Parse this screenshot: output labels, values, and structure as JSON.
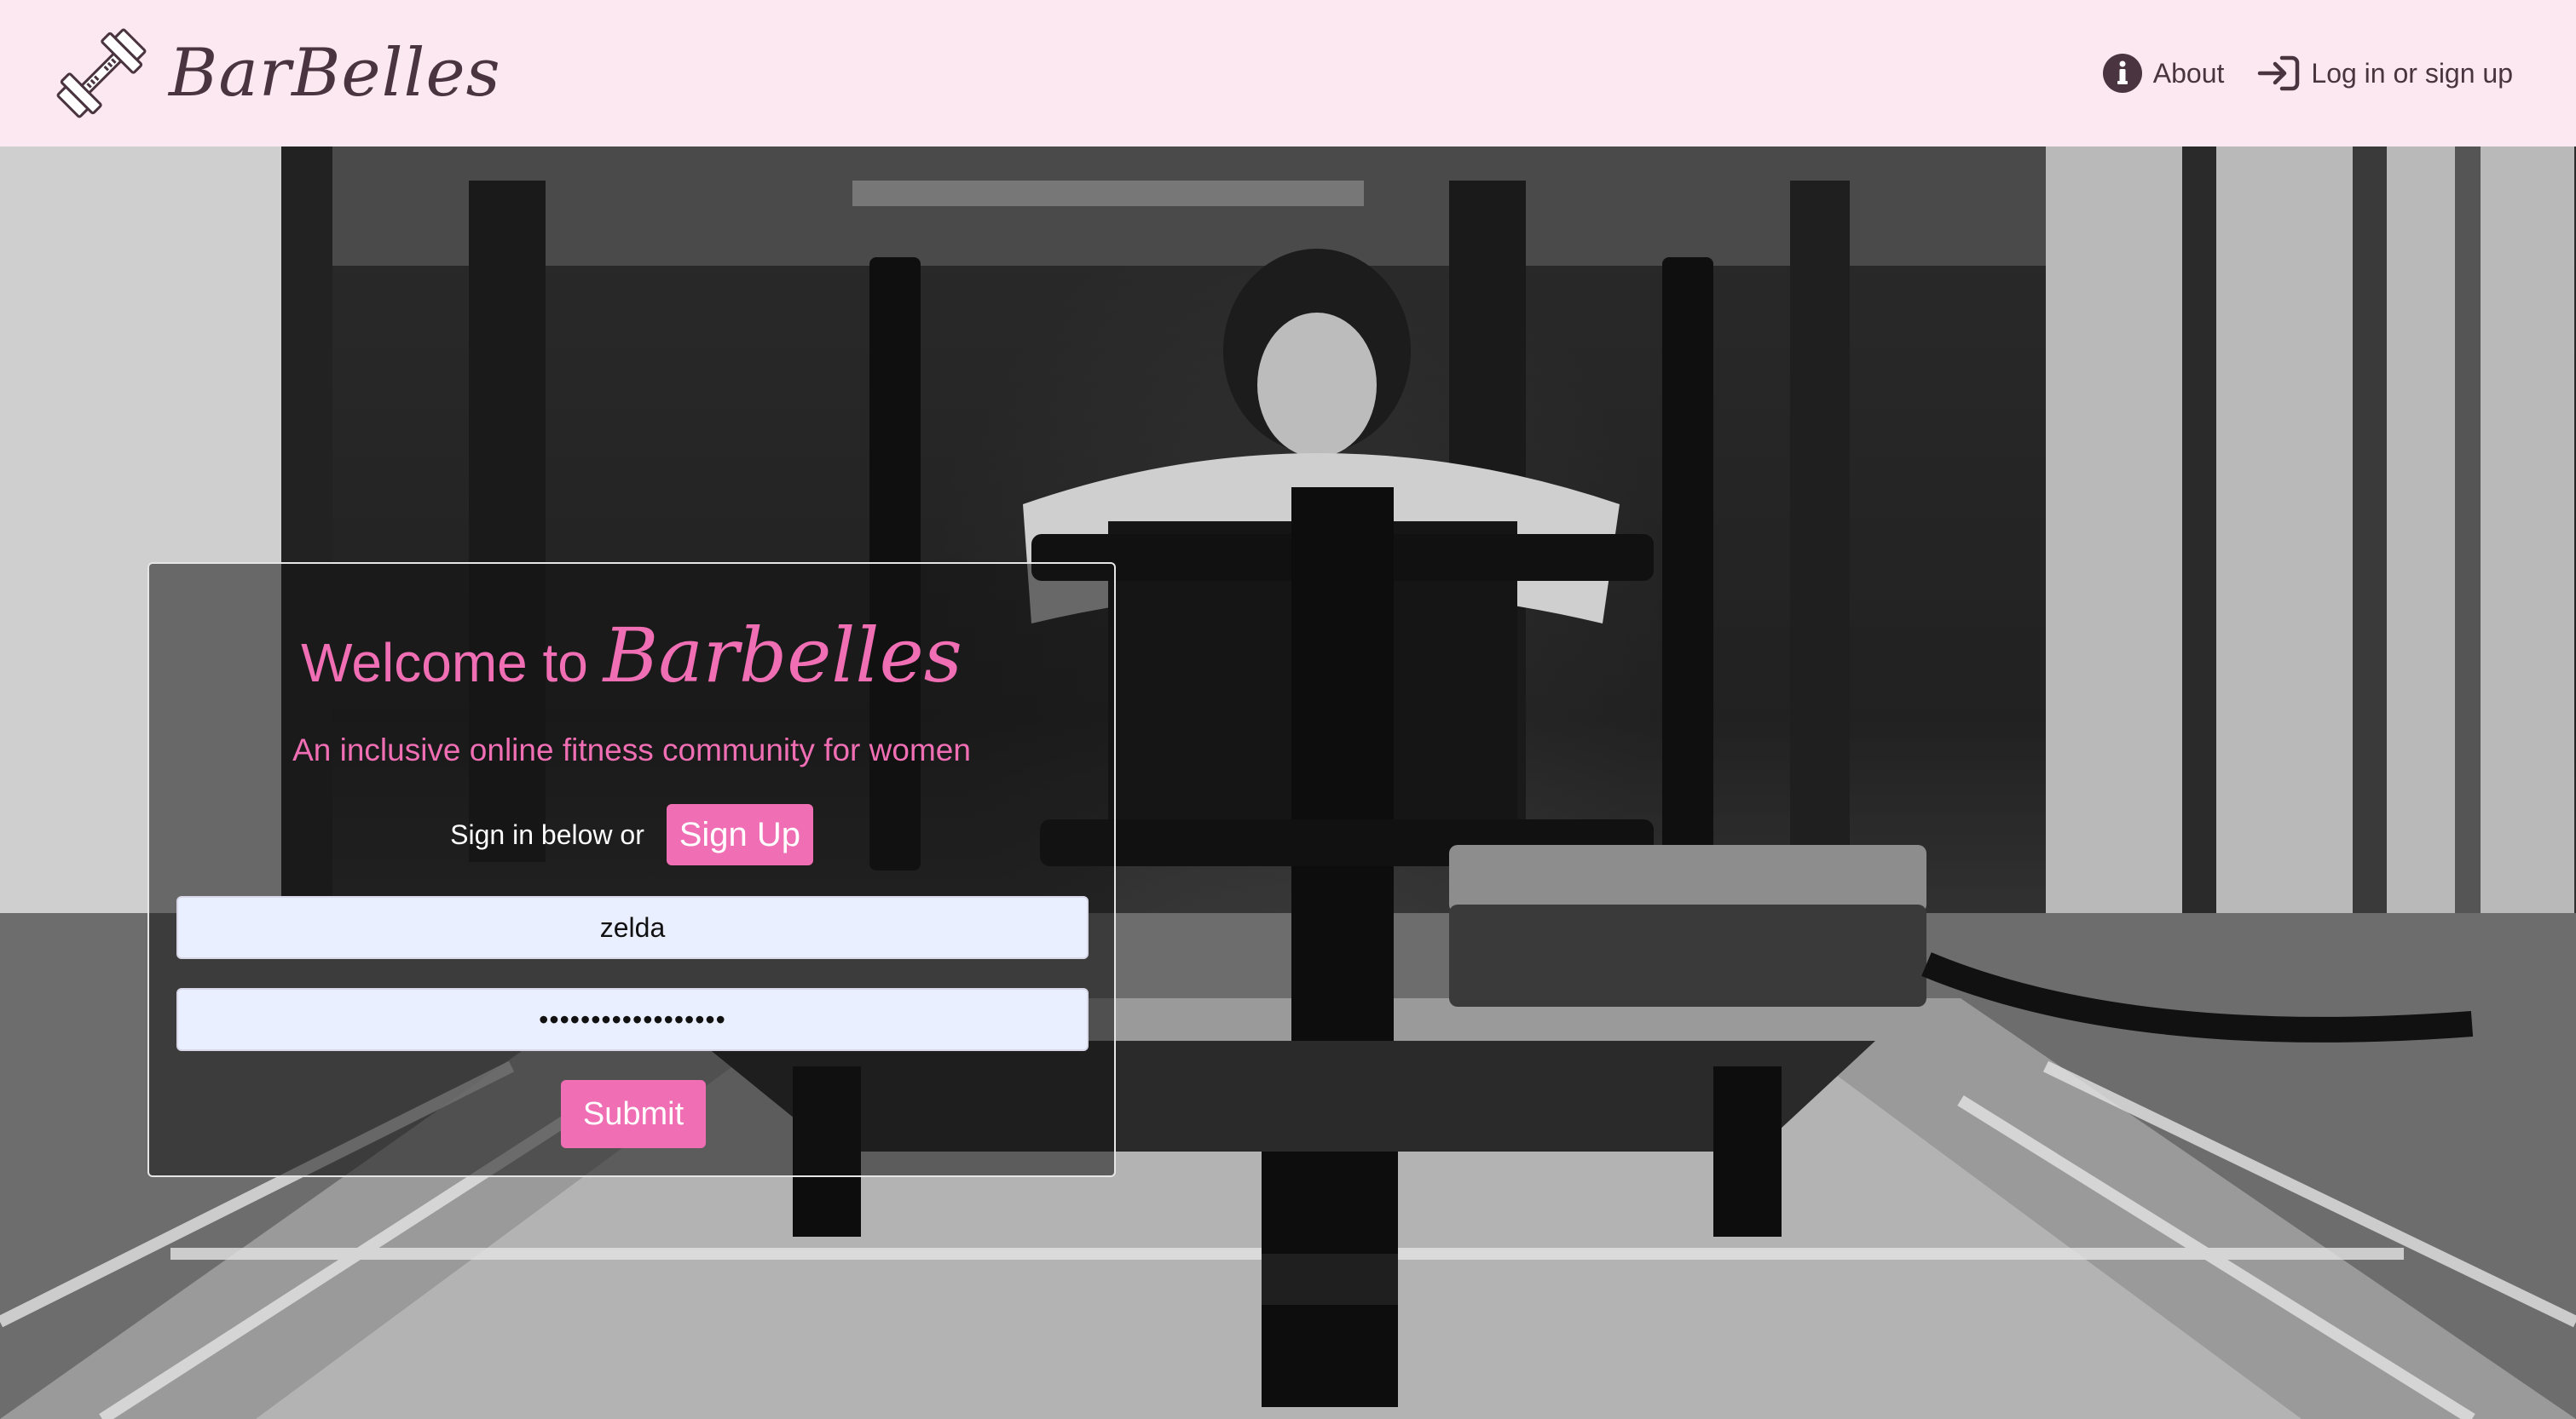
{
  "navbar": {
    "brand_name": "BarBelles",
    "brand_icon": "barbell-icon",
    "about_label": "About",
    "about_icon": "info-circle-icon",
    "login_label": "Log in or sign up",
    "login_icon": "sign-in-icon"
  },
  "card": {
    "welcome_prefix": "Welcome to",
    "welcome_brand": "Barbelles",
    "tagline": "An inclusive online fitness community for women",
    "signin_text": "Sign in below or",
    "signup_button": "Sign Up",
    "username_value": "zelda",
    "password_value": "••••••••••••••••••",
    "submit_button": "Submit"
  },
  "colors": {
    "navbar_bg": "#fce8f1",
    "accent_pink": "#f06eb3",
    "nav_text": "#4a3440",
    "input_bg": "#eaefff"
  }
}
